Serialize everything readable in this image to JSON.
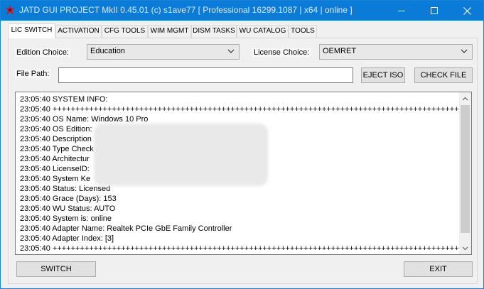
{
  "window": {
    "title": "JATD GUI PROJECT MkII 0.45.01 (c) s1ave77 [ Professional 16299.1087 | x64 | online ]"
  },
  "tabs": [
    {
      "label": "LIC SWITCH",
      "active": true
    },
    {
      "label": "ACTIVATION"
    },
    {
      "label": "CFG TOOLS"
    },
    {
      "label": "WIM MGMT"
    },
    {
      "label": "DISM TASKS"
    },
    {
      "label": "WU CATALOG"
    },
    {
      "label": "TOOLS"
    }
  ],
  "form": {
    "edition_label": "Edition Choice:",
    "edition_value": "Education",
    "license_label": "License Choice:",
    "license_value": "OEMRET",
    "filepath_label": "File Path:",
    "filepath_value": "",
    "eject_iso": "EJECT ISO",
    "check_file": "CHECK FILE"
  },
  "log": [
    "23:05:40 SYSTEM INFO:",
    "23:05:40 ++++++++++++++++++++++++++++++++++++++++++++++++++++++++++++++++++++++++++++++++++++++++++++",
    "23:05:40 OS Name: Windows 10 Pro",
    "23:05:40 OS Edition:",
    "23:05:40 Description",
    "23:05:40 Type Check",
    "23:05:40 Architectur",
    "23:05:40 LicenseID:",
    "23:05:40 System Ke",
    "23:05:40 Status: Licensed",
    "23:05:40 Grace (Days): 153",
    "23:05:40 WU Status: AUTO",
    "23:05:40 System is: online",
    "23:05:40 Adapter Name: Realtek PCIe GbE Family Controller",
    "23:05:40 Adapter Index: [3]",
    "23:05:40 ++++++++++++++++++++++++++++++++++++++++++++++++++++++++++++++++++++++++++++++++++++++++++++"
  ],
  "footer": {
    "switch": "SWITCH",
    "exit": "EXIT"
  }
}
